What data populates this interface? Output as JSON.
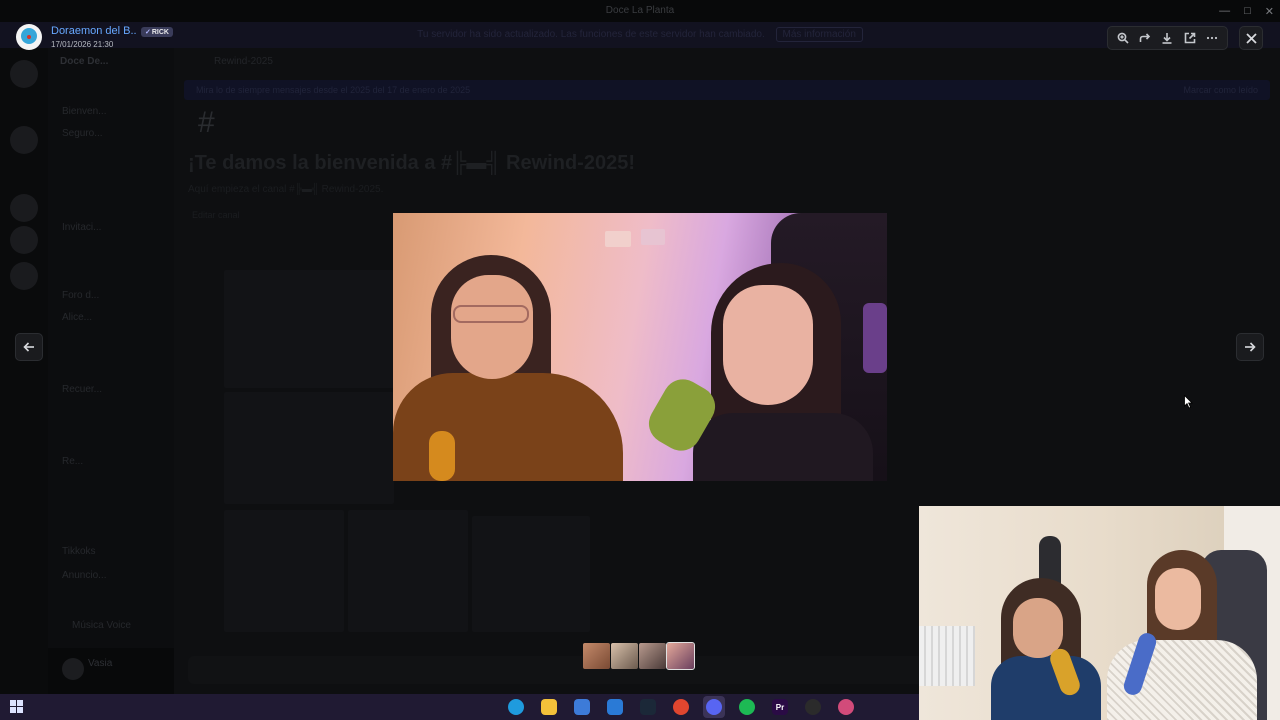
{
  "window": {
    "title": "Doce La Planta",
    "notice": "Tu servidor ha sido actualizado. Las funciones de este servidor han cambiado.",
    "notice_button": "Más información"
  },
  "viewer": {
    "uploader_name": "Doraemon del B...",
    "role_tag": "RICK",
    "timestamp": "17/01/2026 21:30",
    "tools": [
      {
        "icon": "zoom-in-icon",
        "label": "Zoom"
      },
      {
        "icon": "forward-icon",
        "label": "Forward"
      },
      {
        "icon": "download-icon",
        "label": "Download"
      },
      {
        "icon": "open-external-icon",
        "label": "Open in browser"
      },
      {
        "icon": "more-icon",
        "label": "More"
      }
    ],
    "close_label": "Close",
    "prev_label": "Previous",
    "next_label": "Next",
    "thumbnail_count": 4,
    "active_thumbnail": 4
  },
  "background": {
    "server_name": "Doce De...",
    "channel_header": "Rewind-2025",
    "banner": "Mira lo de siempre  mensajes desde el 2025  del 17 de enero de 2025",
    "banner_right": "Marcar como leído",
    "welcome_title": "¡Te damos la bienvenida a #╠▬╣ Rewind-2025!",
    "welcome_subtitle": "Aquí empieza el canal #╠▬╣ Rewind-2025.",
    "edit_channel": "Editar canal",
    "channels": [
      "Bienven...",
      "Seguro...",
      "Invitaci...",
      "Foro d...",
      "Alice...",
      "Recuer...",
      "Re...",
      "Tikkoks",
      "Anuncio..."
    ],
    "voice_label": "Música Voice",
    "user_name": "Vasia"
  },
  "taskbar": {
    "apps": [
      {
        "icon": "edge-icon",
        "color": "#1f9bde"
      },
      {
        "icon": "file-explorer-icon",
        "color": "#f3c13a"
      },
      {
        "icon": "store-icon",
        "color": "#3d7bd8"
      },
      {
        "icon": "mail-icon",
        "color": "#2a7ad6"
      },
      {
        "icon": "steam-icon",
        "color": "#1b2838"
      },
      {
        "icon": "chrome-icon",
        "color": "#e0462f"
      },
      {
        "icon": "discord-icon",
        "color": "#5865f2"
      },
      {
        "icon": "spotify-icon",
        "color": "#1db954"
      },
      {
        "icon": "premiere-icon",
        "color": "#2a0b45",
        "label": "Pr"
      },
      {
        "icon": "obs-icon",
        "color": "#2b2b2b"
      },
      {
        "icon": "photos-icon",
        "color": "#d24b7a"
      }
    ]
  },
  "colors": {
    "accent_link": "#67a8ff",
    "viewer_button_bg": "#1b1c20",
    "taskbar_bg": "#201a33"
  }
}
